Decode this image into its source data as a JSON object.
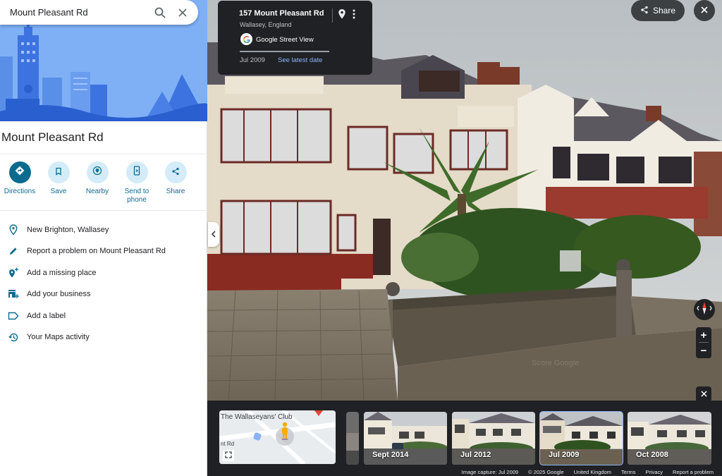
{
  "search": {
    "query": "Mount Pleasant Rd"
  },
  "place": {
    "title": "Mount Pleasant Rd",
    "actions": [
      {
        "label": "Directions",
        "icon": "directions-icon"
      },
      {
        "label": "Save",
        "icon": "bookmark-icon"
      },
      {
        "label": "Nearby",
        "icon": "nearby-icon"
      },
      {
        "label": "Send to phone",
        "icon": "phone-icon"
      },
      {
        "label": "Share",
        "icon": "share-icon"
      }
    ],
    "details": [
      {
        "text": "New Brighton, Wallasey",
        "icon": "location-pin-icon"
      },
      {
        "text": "Report a problem on Mount Pleasant Rd",
        "icon": "pencil-icon"
      },
      {
        "text": "Add a missing place",
        "icon": "add-place-icon"
      },
      {
        "text": "Add your business",
        "icon": "add-business-icon"
      },
      {
        "text": "Add a label",
        "icon": "label-icon"
      },
      {
        "text": "Your Maps activity",
        "icon": "history-icon"
      }
    ]
  },
  "street_view": {
    "address": "157 Mount Pleasant Rd",
    "locality": "Wallasey, England",
    "source": "Google Street View",
    "date": "Jul 2009",
    "latest_link": "See latest date",
    "share_label": "Share"
  },
  "minimap": {
    "place_label": "The Wallaseyans' Club",
    "road_label": "nt Rd"
  },
  "timeline": [
    {
      "label": "Sept 2014",
      "selected": false
    },
    {
      "label": "Jul 2012",
      "selected": false
    },
    {
      "label": "Jul 2009",
      "selected": true
    },
    {
      "label": "Oct 2008",
      "selected": false
    }
  ],
  "footer": {
    "capture": "Image capture: Jul 2009",
    "copyright": "© 2025 Google",
    "region": "United Kingdom",
    "terms": "Terms",
    "privacy": "Privacy",
    "report": "Report a problem"
  },
  "colors": {
    "accent": "#0b6b8f",
    "action_bg": "#d3ecf7",
    "hero_bg": "#7fb0f5",
    "dark_ui": "#202124",
    "link": "#8ab4f8"
  }
}
